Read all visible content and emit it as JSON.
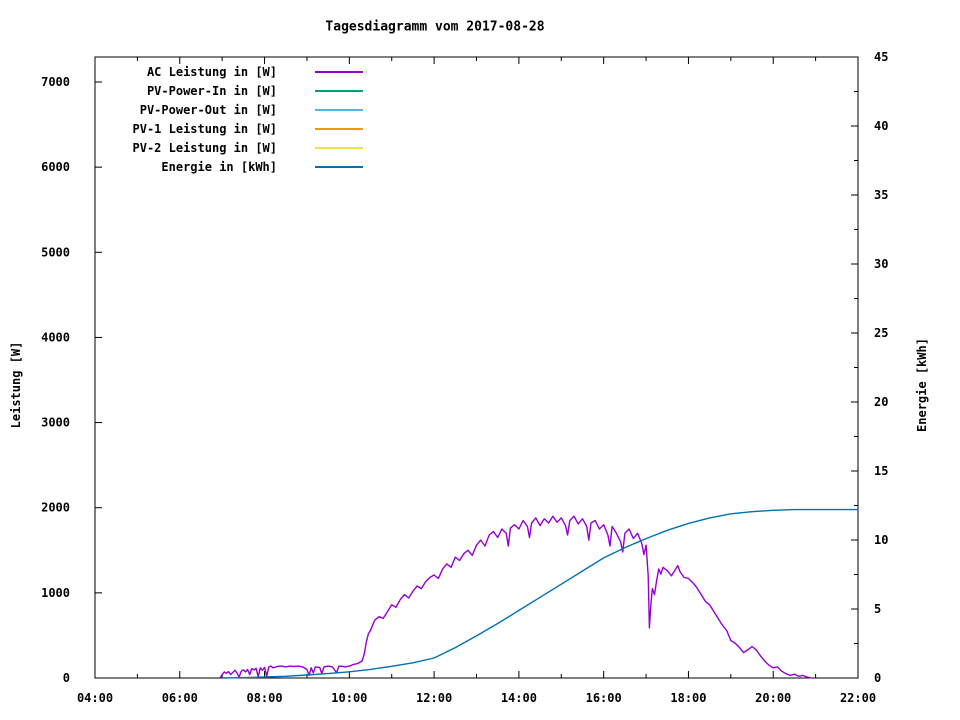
{
  "chart_data": {
    "type": "line",
    "title": "Tagesdiagramm vom 2017-08-28",
    "ylabel": "Leistung [W]",
    "y2label": "Energie [kWh]",
    "x_range_hours": [
      4,
      22
    ],
    "x_major_step_hours": 2,
    "x_minor_step_hours": 1,
    "x_tick_labels": [
      "04:00",
      "06:00",
      "08:00",
      "10:00",
      "12:00",
      "14:00",
      "16:00",
      "18:00",
      "20:00",
      "22:00"
    ],
    "y_range": [
      0,
      7000
    ],
    "y_tick_step": 1000,
    "y2_range": [
      0,
      45
    ],
    "y2_tick_step": 5,
    "y2_minor_step": 2.5,
    "grid": false,
    "legend_position": "top-left-inside",
    "legend": [
      {
        "label": "AC Leistung in [W]",
        "color": "#9400d3"
      },
      {
        "label": "PV-Power-In in [W]",
        "color": "#009e73"
      },
      {
        "label": "PV-Power-Out in [W]",
        "color": "#56b4e9"
      },
      {
        "label": "PV-1 Leistung in [W]",
        "color": "#e69f00"
      },
      {
        "label": "PV-2 Leistung in [W]",
        "color": "#f0e442"
      },
      {
        "label": "Energie in [kWh]",
        "color": "#0072b2"
      }
    ],
    "series": [
      {
        "name": "AC Leistung in [W]",
        "axis": "y1",
        "color": "#9400d3",
        "points": [
          [
            6.95,
            0
          ],
          [
            7.0,
            40
          ],
          [
            7.05,
            70
          ],
          [
            7.1,
            55
          ],
          [
            7.15,
            75
          ],
          [
            7.2,
            40
          ],
          [
            7.25,
            65
          ],
          [
            7.3,
            90
          ],
          [
            7.35,
            60
          ],
          [
            7.4,
            10
          ],
          [
            7.45,
            80
          ],
          [
            7.5,
            95
          ],
          [
            7.55,
            70
          ],
          [
            7.6,
            100
          ],
          [
            7.65,
            40
          ],
          [
            7.7,
            110
          ],
          [
            7.75,
            95
          ],
          [
            7.8,
            115
          ],
          [
            7.85,
            15
          ],
          [
            7.9,
            120
          ],
          [
            7.95,
            90
          ],
          [
            8.0,
            125
          ],
          [
            8.05,
            20
          ],
          [
            8.1,
            130
          ],
          [
            8.15,
            140
          ],
          [
            8.2,
            120
          ],
          [
            8.3,
            135
          ],
          [
            8.4,
            140
          ],
          [
            8.5,
            130
          ],
          [
            8.6,
            140
          ],
          [
            8.7,
            135
          ],
          [
            8.8,
            140
          ],
          [
            8.9,
            130
          ],
          [
            9.0,
            100
          ],
          [
            9.05,
            30
          ],
          [
            9.1,
            120
          ],
          [
            9.15,
            60
          ],
          [
            9.2,
            130
          ],
          [
            9.3,
            125
          ],
          [
            9.35,
            50
          ],
          [
            9.4,
            130
          ],
          [
            9.5,
            140
          ],
          [
            9.6,
            130
          ],
          [
            9.7,
            60
          ],
          [
            9.75,
            135
          ],
          [
            9.8,
            140
          ],
          [
            9.9,
            130
          ],
          [
            10.0,
            140
          ],
          [
            10.1,
            160
          ],
          [
            10.2,
            170
          ],
          [
            10.3,
            200
          ],
          [
            10.35,
            280
          ],
          [
            10.4,
            420
          ],
          [
            10.45,
            520
          ],
          [
            10.5,
            560
          ],
          [
            10.55,
            620
          ],
          [
            10.6,
            680
          ],
          [
            10.7,
            720
          ],
          [
            10.8,
            700
          ],
          [
            10.9,
            780
          ],
          [
            11.0,
            860
          ],
          [
            11.1,
            830
          ],
          [
            11.2,
            920
          ],
          [
            11.3,
            980
          ],
          [
            11.4,
            940
          ],
          [
            11.5,
            1020
          ],
          [
            11.6,
            1080
          ],
          [
            11.7,
            1050
          ],
          [
            11.8,
            1130
          ],
          [
            11.9,
            1180
          ],
          [
            12.0,
            1210
          ],
          [
            12.1,
            1170
          ],
          [
            12.2,
            1280
          ],
          [
            12.3,
            1340
          ],
          [
            12.4,
            1300
          ],
          [
            12.5,
            1420
          ],
          [
            12.6,
            1380
          ],
          [
            12.7,
            1460
          ],
          [
            12.8,
            1500
          ],
          [
            12.9,
            1440
          ],
          [
            13.0,
            1560
          ],
          [
            13.1,
            1620
          ],
          [
            13.2,
            1550
          ],
          [
            13.3,
            1680
          ],
          [
            13.4,
            1720
          ],
          [
            13.5,
            1650
          ],
          [
            13.6,
            1750
          ],
          [
            13.7,
            1700
          ],
          [
            13.75,
            1550
          ],
          [
            13.8,
            1760
          ],
          [
            13.9,
            1800
          ],
          [
            14.0,
            1750
          ],
          [
            14.1,
            1850
          ],
          [
            14.2,
            1780
          ],
          [
            14.25,
            1650
          ],
          [
            14.3,
            1820
          ],
          [
            14.4,
            1880
          ],
          [
            14.5,
            1790
          ],
          [
            14.6,
            1870
          ],
          [
            14.7,
            1820
          ],
          [
            14.8,
            1900
          ],
          [
            14.9,
            1830
          ],
          [
            15.0,
            1880
          ],
          [
            15.1,
            1790
          ],
          [
            15.15,
            1680
          ],
          [
            15.2,
            1850
          ],
          [
            15.3,
            1900
          ],
          [
            15.4,
            1810
          ],
          [
            15.5,
            1870
          ],
          [
            15.6,
            1780
          ],
          [
            15.65,
            1620
          ],
          [
            15.7,
            1820
          ],
          [
            15.8,
            1850
          ],
          [
            15.9,
            1750
          ],
          [
            16.0,
            1800
          ],
          [
            16.1,
            1680
          ],
          [
            16.15,
            1550
          ],
          [
            16.2,
            1780
          ],
          [
            16.3,
            1700
          ],
          [
            16.4,
            1600
          ],
          [
            16.45,
            1480
          ],
          [
            16.5,
            1700
          ],
          [
            16.6,
            1750
          ],
          [
            16.7,
            1640
          ],
          [
            16.8,
            1700
          ],
          [
            16.9,
            1580
          ],
          [
            16.95,
            1450
          ],
          [
            17.0,
            1560
          ],
          [
            17.05,
            1200
          ],
          [
            17.08,
            590
          ],
          [
            17.12,
            900
          ],
          [
            17.15,
            1050
          ],
          [
            17.2,
            980
          ],
          [
            17.25,
            1150
          ],
          [
            17.3,
            1280
          ],
          [
            17.35,
            1220
          ],
          [
            17.4,
            1300
          ],
          [
            17.5,
            1260
          ],
          [
            17.6,
            1200
          ],
          [
            17.7,
            1280
          ],
          [
            17.75,
            1320
          ],
          [
            17.8,
            1250
          ],
          [
            17.9,
            1180
          ],
          [
            18.0,
            1170
          ],
          [
            18.1,
            1120
          ],
          [
            18.2,
            1060
          ],
          [
            18.3,
            980
          ],
          [
            18.4,
            900
          ],
          [
            18.5,
            860
          ],
          [
            18.6,
            780
          ],
          [
            18.7,
            700
          ],
          [
            18.8,
            620
          ],
          [
            18.9,
            560
          ],
          [
            19.0,
            440
          ],
          [
            19.1,
            410
          ],
          [
            19.2,
            360
          ],
          [
            19.3,
            300
          ],
          [
            19.4,
            330
          ],
          [
            19.5,
            370
          ],
          [
            19.6,
            330
          ],
          [
            19.7,
            260
          ],
          [
            19.8,
            200
          ],
          [
            19.9,
            150
          ],
          [
            20.0,
            120
          ],
          [
            20.1,
            130
          ],
          [
            20.2,
            80
          ],
          [
            20.3,
            50
          ],
          [
            20.4,
            30
          ],
          [
            20.5,
            45
          ],
          [
            20.6,
            20
          ],
          [
            20.7,
            30
          ],
          [
            20.8,
            10
          ],
          [
            20.9,
            0
          ]
        ]
      },
      {
        "name": "Energie in [kWh]",
        "axis": "y2",
        "color": "#0072b2",
        "points": [
          [
            7.0,
            0
          ],
          [
            7.5,
            0.03
          ],
          [
            8.0,
            0.07
          ],
          [
            8.5,
            0.12
          ],
          [
            9.0,
            0.22
          ],
          [
            9.5,
            0.32
          ],
          [
            10.0,
            0.45
          ],
          [
            10.5,
            0.62
          ],
          [
            11.0,
            0.85
          ],
          [
            11.5,
            1.1
          ],
          [
            12.0,
            1.45
          ],
          [
            12.5,
            2.2
          ],
          [
            13.0,
            3.05
          ],
          [
            13.5,
            3.95
          ],
          [
            14.0,
            4.9
          ],
          [
            14.5,
            5.85
          ],
          [
            15.0,
            6.8
          ],
          [
            15.5,
            7.75
          ],
          [
            16.0,
            8.7
          ],
          [
            16.5,
            9.45
          ],
          [
            17.0,
            10.1
          ],
          [
            17.5,
            10.7
          ],
          [
            18.0,
            11.2
          ],
          [
            18.5,
            11.6
          ],
          [
            19.0,
            11.9
          ],
          [
            19.5,
            12.05
          ],
          [
            20.0,
            12.15
          ],
          [
            20.5,
            12.2
          ],
          [
            21.0,
            12.2
          ],
          [
            21.5,
            12.2
          ],
          [
            22.0,
            12.2
          ]
        ]
      }
    ]
  }
}
